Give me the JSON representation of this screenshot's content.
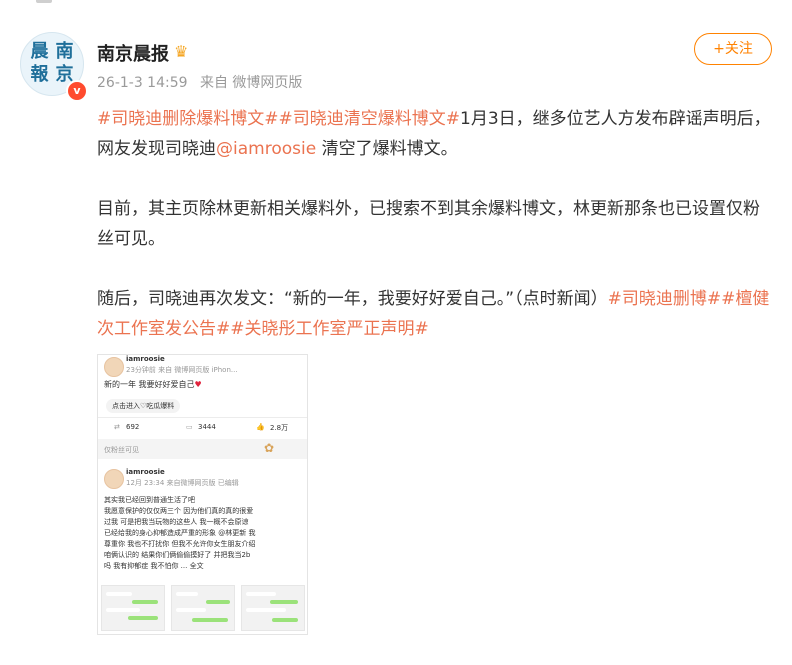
{
  "post": {
    "author_name": "南京晨报",
    "avatar_text": [
      "晨",
      "南",
      "報",
      "京"
    ],
    "verified_mark": "v",
    "timestamp": "26-1-3 14:59",
    "source": "来自 微博网页版",
    "follow_label": "+关注",
    "paragraph1": {
      "tag1": "#司晓迪删除爆料博文#",
      "tag2": "#司晓迪清空爆料博文#",
      "text1": "1月3日，继多位艺人方发布辟谣声明后，网友发现司晓迪",
      "mention": "@iamroosie",
      "text2": " 清空了爆料博文。"
    },
    "paragraph2": "目前，其主页除林更新相关爆料外，已搜索不到其余爆料博文，林更新那条也已设置仅粉丝可见。",
    "paragraph3": {
      "text": "随后，司晓迪再次发文：“新的一年，我要好好爱自己。”（点时新闻）",
      "tag3": "#司晓迪删博#",
      "tag4": "#檀健次工作室发公告#",
      "tag5": "#关晓彤工作室严正声明#"
    }
  },
  "embedded_image": {
    "top_post": {
      "username": "iamroosie",
      "meta": "23分钟前 来自 微博网页版 iPhon...",
      "body": "新的一年 我要好好爱自己",
      "topic": "点击进入♡吃瓜爆料",
      "reposts": "692",
      "comments": "3444",
      "likes": "2.8万"
    },
    "visibility_label": "仅粉丝可见",
    "second_post": {
      "username": "iamroosie",
      "meta": "12月 23:34 来自微博网页版 已编辑",
      "lines": [
        "其实我已经回到普通生活了吧",
        "我愿意保护的仅仅两三个 因为他们真的真的很爱",
        "过我 可是把我当玩物的这些人 我一概不会原谅",
        "已经给我的身心抑郁造成严重的形象 @林更新 我",
        "尊重你 我也不打扰你 但我不允许你女生朋友介绍",
        "咱俩认识的 结果你们俩偷偷摸好了 并把我当2b",
        "吗 我有抑郁症 我不怕你 ... 全文"
      ]
    }
  },
  "colors": {
    "accent": "#ff8200",
    "link": "#eb7350",
    "text": "#333333",
    "muted": "#9a9a9a",
    "verified": "#ff4b2e"
  }
}
